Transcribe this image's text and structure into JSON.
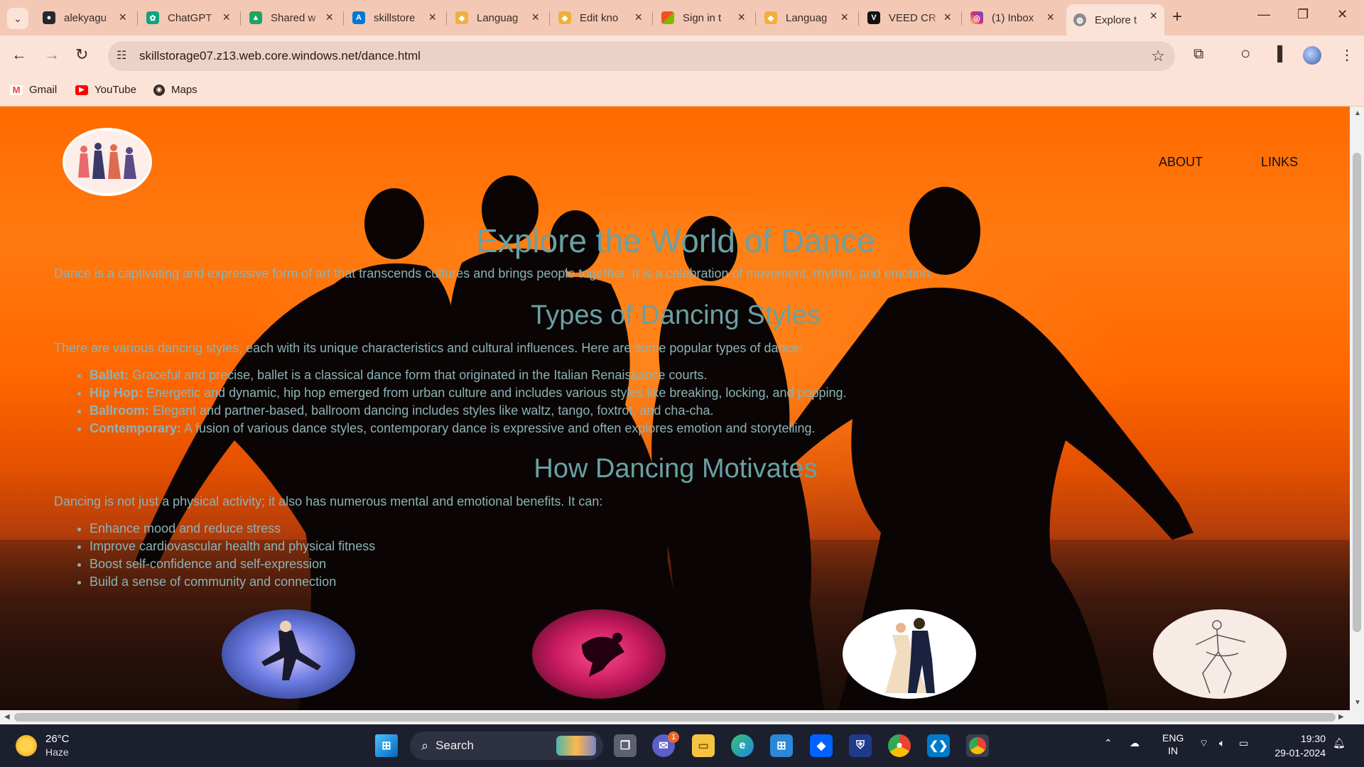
{
  "browser": {
    "tabs": [
      {
        "title": "alekyagu",
        "favicon": "github-icon",
        "color": "#24292f",
        "glyph": "●"
      },
      {
        "title": "ChatGPT",
        "favicon": "chatgpt-icon",
        "color": "#10a37f",
        "glyph": "✿"
      },
      {
        "title": "Shared w",
        "favicon": "google-drive-icon",
        "color": "#1fa463",
        "glyph": "▲"
      },
      {
        "title": "skillstore",
        "favicon": "azure-icon",
        "color": "#0078d4",
        "glyph": "A"
      },
      {
        "title": "Languag",
        "favicon": "language-icon",
        "color": "#f0b03c",
        "glyph": "◆"
      },
      {
        "title": "Edit kno",
        "favicon": "language-icon",
        "color": "#f0b03c",
        "glyph": "◆"
      },
      {
        "title": "Sign in t",
        "favicon": "microsoft-icon",
        "color": "#f25022",
        "glyph": "■"
      },
      {
        "title": "Languag",
        "favicon": "language-icon",
        "color": "#f0b03c",
        "glyph": "◆"
      },
      {
        "title": "VEED CR",
        "favicon": "veed-icon",
        "color": "#111111",
        "glyph": "V"
      },
      {
        "title": "(1) Inbox",
        "favicon": "instagram-icon",
        "color": "#d6249f",
        "glyph": "◎"
      },
      {
        "title": "Explore t",
        "favicon": "globe-icon",
        "color": "#8a8a8a",
        "glyph": "◍",
        "active": true
      }
    ],
    "url": "skillstorage07.z13.web.core.windows.net/dance.html",
    "bookmarks": [
      {
        "label": "Gmail",
        "icon": "gmail-icon",
        "color": "#ea4335",
        "glyph": "M"
      },
      {
        "label": "YouTube",
        "icon": "youtube-icon",
        "color": "#ff0000",
        "glyph": "▶"
      },
      {
        "label": "Maps",
        "icon": "maps-icon",
        "color": "#3a2a25",
        "glyph": "◉"
      }
    ]
  },
  "page": {
    "nav": {
      "about": "ABOUT",
      "links": "LINKS"
    },
    "title": "Explore the World of Dance",
    "intro": "Dance is a captivating and expressive form of art that transcends cultures and brings people together. It is a celebration of movement, rhythm, and emotion.",
    "styles_heading": "Types of Dancing Styles",
    "styles_intro": "There are various dancing styles, each with its unique characteristics and cultural influences. Here are some popular types of dance:",
    "styles": [
      {
        "name": "Ballet:",
        "desc": " Graceful and precise, ballet is a classical dance form that originated in the Italian Renaissance courts."
      },
      {
        "name": "Hip Hop:",
        "desc": " Energetic and dynamic, hip hop emerged from urban culture and includes various styles like breaking, locking, and popping."
      },
      {
        "name": "Ballroom:",
        "desc": " Elegant and partner-based, ballroom dancing includes styles like waltz, tango, foxtrot, and cha-cha."
      },
      {
        "name": "Contemporary:",
        "desc": " A fusion of various dance styles, contemporary dance is expressive and often explores emotion and storytelling."
      }
    ],
    "motivates_heading": "How Dancing Motivates",
    "motivates_intro": "Dancing is not just a physical activity; it also has numerous mental and emotional benefits. It can:",
    "benefits": [
      "Enhance mood and reduce stress",
      "Improve cardiovascular health and physical fitness",
      "Boost self-confidence and self-expression",
      "Build a sense of community and connection"
    ]
  },
  "taskbar": {
    "weather_temp": "26°C",
    "weather_cond": "Haze",
    "search_label": "Search",
    "lang_top": "ENG",
    "lang_bottom": "IN",
    "time": "19:30",
    "date": "29-01-2024",
    "teams_badge": "1"
  }
}
